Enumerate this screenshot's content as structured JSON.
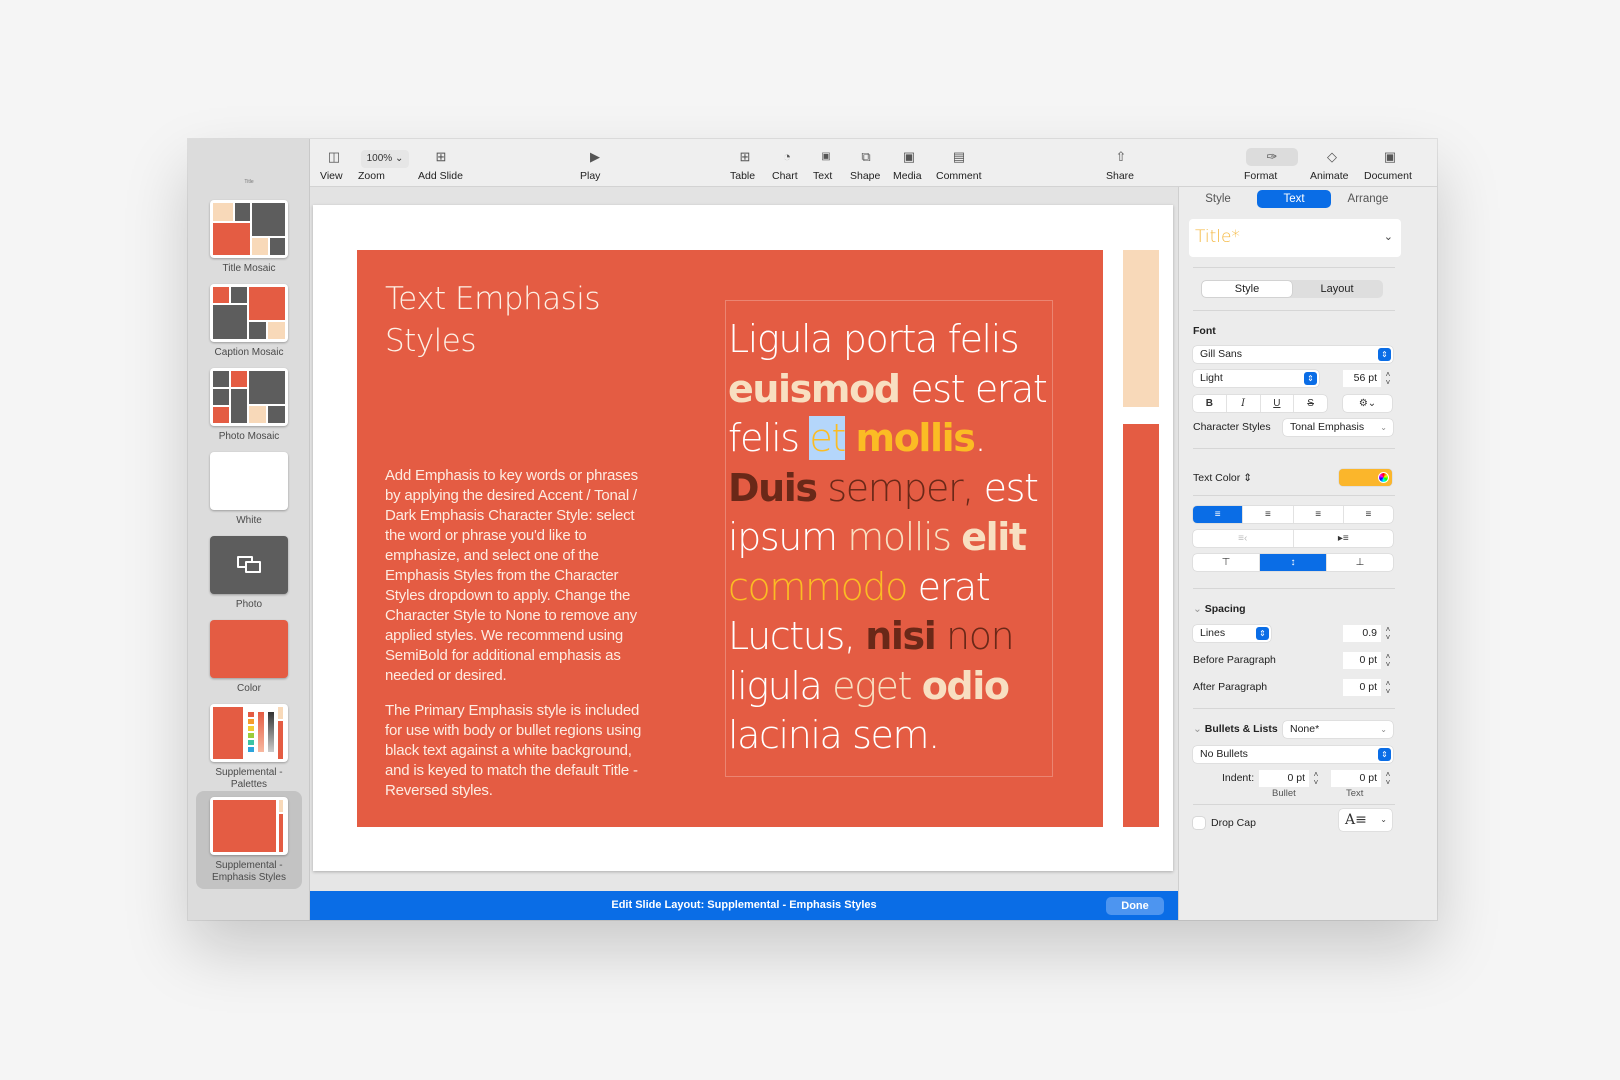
{
  "toolbar": {
    "view": "View",
    "zoom_value": "100%",
    "zoom": "Zoom",
    "add_slide": "Add Slide",
    "play": "Play",
    "table": "Table",
    "chart": "Chart",
    "text": "Text",
    "shape": "Shape",
    "media": "Media",
    "comment": "Comment",
    "share": "Share",
    "format": "Format",
    "animate": "Animate",
    "document": "Document"
  },
  "navigator": {
    "top_label": "Title",
    "items": [
      {
        "label": "Title Mosaic"
      },
      {
        "label": "Caption Mosaic"
      },
      {
        "label": "Photo Mosaic"
      },
      {
        "label": "White"
      },
      {
        "label": "Photo"
      },
      {
        "label": "Color"
      },
      {
        "label": "Supplemental - Palettes"
      },
      {
        "label": "Supplemental - Emphasis Styles",
        "selected": true
      }
    ]
  },
  "slide": {
    "title_line1": "Text Emphasis",
    "title_line2": "Styles",
    "body_p1": "Add Emphasis to key words or phrases by applying the desired Accent / Tonal / Dark Emphasis Character Style: select the word or phrase you'd like to emphasize, and select one of the Emphasis Styles from the Character Styles dropdown to apply. Change the Character Style to None to remove any applied styles.  We recommend using SemiBold for additional emphasis as needed or desired.",
    "body_p2": "The Primary Emphasis style is included for use with body or bullet regions using black text against a white background, and is keyed to match the default Title - Reversed styles.",
    "emphasis": {
      "w1": "Ligula porta felis",
      "w2": "euismod",
      "w3": " est erat",
      "w4": "felis ",
      "w5": "et",
      "w6": " ",
      "w7": "mollis",
      "w8": ".",
      "w9": "Duis",
      "w10": " semper,",
      "w11": " est",
      "w12": "ipsum ",
      "w13": "mollis ",
      "w14": "elit",
      "w15": "commodo",
      "w16": " erat",
      "w17": "Luctus, ",
      "w18": "nisi",
      "w19": " non",
      "w20": "ligula ",
      "w21": "eget ",
      "w22": "odio",
      "w23": "lacinia sem."
    },
    "colors": {
      "background": "#e45c43",
      "tonal": "#f8dfc1",
      "accent": "#fbbc24",
      "dark": "#6a2818"
    }
  },
  "edit_bar": {
    "text": "Edit Slide Layout: Supplemental - Emphasis Styles",
    "done": "Done"
  },
  "inspector": {
    "tabs": [
      "Style",
      "Text",
      "Arrange"
    ],
    "active_tab": "Text",
    "paragraph_style": "Title*",
    "sub_tabs": [
      "Style",
      "Layout"
    ],
    "font_label": "Font",
    "font_family": "Gill Sans",
    "font_weight": "Light",
    "font_size": "56 pt",
    "bold": "B",
    "italic": "I",
    "underline": "U",
    "strike": "S",
    "char_styles_label": "Character Styles",
    "char_style_value": "Tonal Emphasis",
    "text_color_label": "Text Color",
    "text_color": "#fbb62b",
    "spacing_label": "Spacing",
    "spacing_mode": "Lines",
    "spacing_value": "0.9",
    "before_para_label": "Before Paragraph",
    "before_para_value": "0 pt",
    "after_para_label": "After Paragraph",
    "after_para_value": "0 pt",
    "bullets_label": "Bullets & Lists",
    "bullets_value": "None*",
    "bullet_type": "No Bullets",
    "indent_label": "Indent:",
    "indent_bullet": "0 pt",
    "indent_text": "0 pt",
    "bullet_caption": "Bullet",
    "text_caption": "Text",
    "drop_cap_label": "Drop Cap"
  }
}
